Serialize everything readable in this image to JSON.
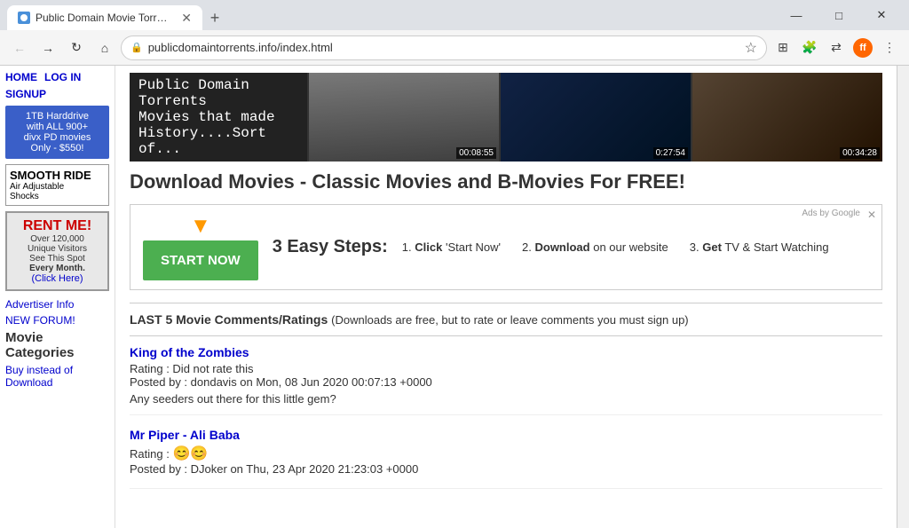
{
  "browser": {
    "tab_title": "Public Domain Movie Torrents w...",
    "url": "publicdomaintorrents.info/index.html",
    "new_tab_icon": "+",
    "minimize": "—",
    "maximize": "□",
    "close": "✕"
  },
  "sidebar": {
    "nav_home": "HOME",
    "nav_login": "LOG IN",
    "nav_signup": "SIGNUP",
    "ad1_line1": "1TB Harddrive",
    "ad1_line2": "with ALL 900+",
    "ad1_line3": "divx PD movies",
    "ad1_line4": "Only - $550!",
    "smooth_title": "SMOOTH RIDE",
    "smooth_sub1": "Air Adjustable",
    "smooth_sub2": "Shocks",
    "rent_title": "RENT ME!",
    "rent_line1": "Over 120,000",
    "rent_line2": "Unique Visitors",
    "rent_line3": "See This Spot",
    "rent_line4": "Every Month.",
    "rent_link": "(Click Here)",
    "advertiser_link": "Advertiser Info",
    "forum_link": "NEW FORUM!",
    "categories_title": "Movie Categories",
    "buy_link": "Buy instead of Download"
  },
  "banner": {
    "title": "Public Domain Torrents",
    "subtitle": "Movies that made History....Sort of...",
    "thumb1_time": "00:08:55",
    "thumb2_time": "0:27:54",
    "thumb3_time": "00:34:28"
  },
  "main": {
    "page_title": "Download Movies - Classic Movies and B-Movies For FREE!",
    "ad_arrow": "▼",
    "start_now_label": "START NOW",
    "easy_steps_label": "3 Easy Steps:",
    "step1_num": "1.",
    "step1_action": "Click",
    "step1_text": "'Start Now'",
    "step2_num": "2.",
    "step2_action": "Download",
    "step2_text": "on our website",
    "step3_num": "3.",
    "step3_action": "Get",
    "step3_text": "TV & Start Watching",
    "comments_header": "LAST 5 Movie Comments/Ratings",
    "comments_note": "(Downloads are free, but to rate or leave comments you must sign up)",
    "comment1_movie": "King of the Zombies",
    "comment1_rating": "Rating : Did not rate this",
    "comment1_posted": "Posted by : dondavis on Mon, 08 Jun 2020 00:07:13 +0000",
    "comment1_text": "Any seeders out there for this little gem?",
    "comment2_movie": "Mr Piper - Ali Baba",
    "comment2_rating": "Rating :",
    "comment2_rating_emoji": "😊😊",
    "comment2_posted": "Posted by : DJoker on Thu, 23 Apr 2020 21:23:03 +0000"
  }
}
